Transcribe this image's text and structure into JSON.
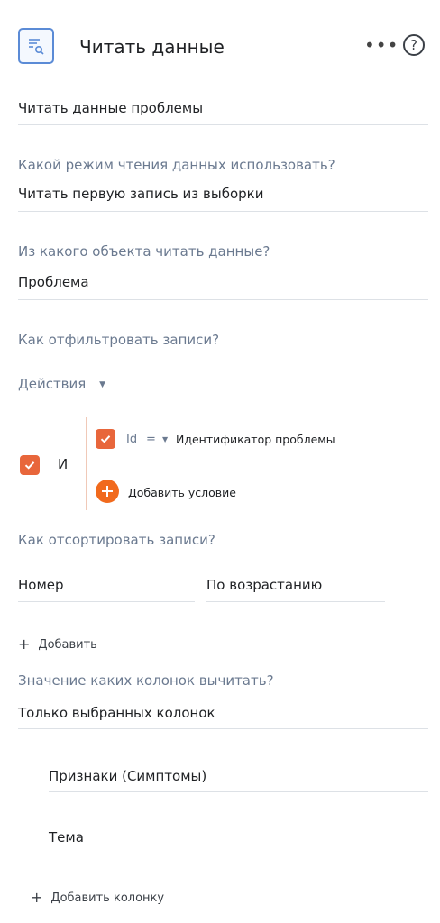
{
  "header": {
    "icon": "read-data-icon",
    "title": "Читать данные",
    "more": "•••",
    "help": "?"
  },
  "element_name": "Читать данные проблемы",
  "read_mode": {
    "label": "Какой режим чтения данных использовать?",
    "value": "Читать первую запись из выборки"
  },
  "object": {
    "label": "Из какого объекта читать данные?",
    "value": "Проблема"
  },
  "filter": {
    "label": "Как отфильтровать записи?",
    "actions_label": "Действия",
    "group_operator": "И",
    "condition": {
      "field": "Id",
      "operator": "=",
      "value": "Идентификатор проблемы"
    },
    "add_condition_label": "Добавить условие"
  },
  "sort": {
    "label": "Как отсортировать записи?",
    "column": "Номер",
    "direction": "По возрастанию",
    "add_label": "Добавить"
  },
  "columns": {
    "label": "Значение каких колонок вычитать?",
    "mode": "Только выбранных колонок",
    "items": [
      "Признаки (Симптомы)",
      "Тема"
    ],
    "add_label": "Добавить колонку"
  },
  "colors": {
    "accent": "#e8663b",
    "add_button": "#f16a1d",
    "icon_blue": "#5b8bd6",
    "label_gray": "#6b7a90"
  }
}
